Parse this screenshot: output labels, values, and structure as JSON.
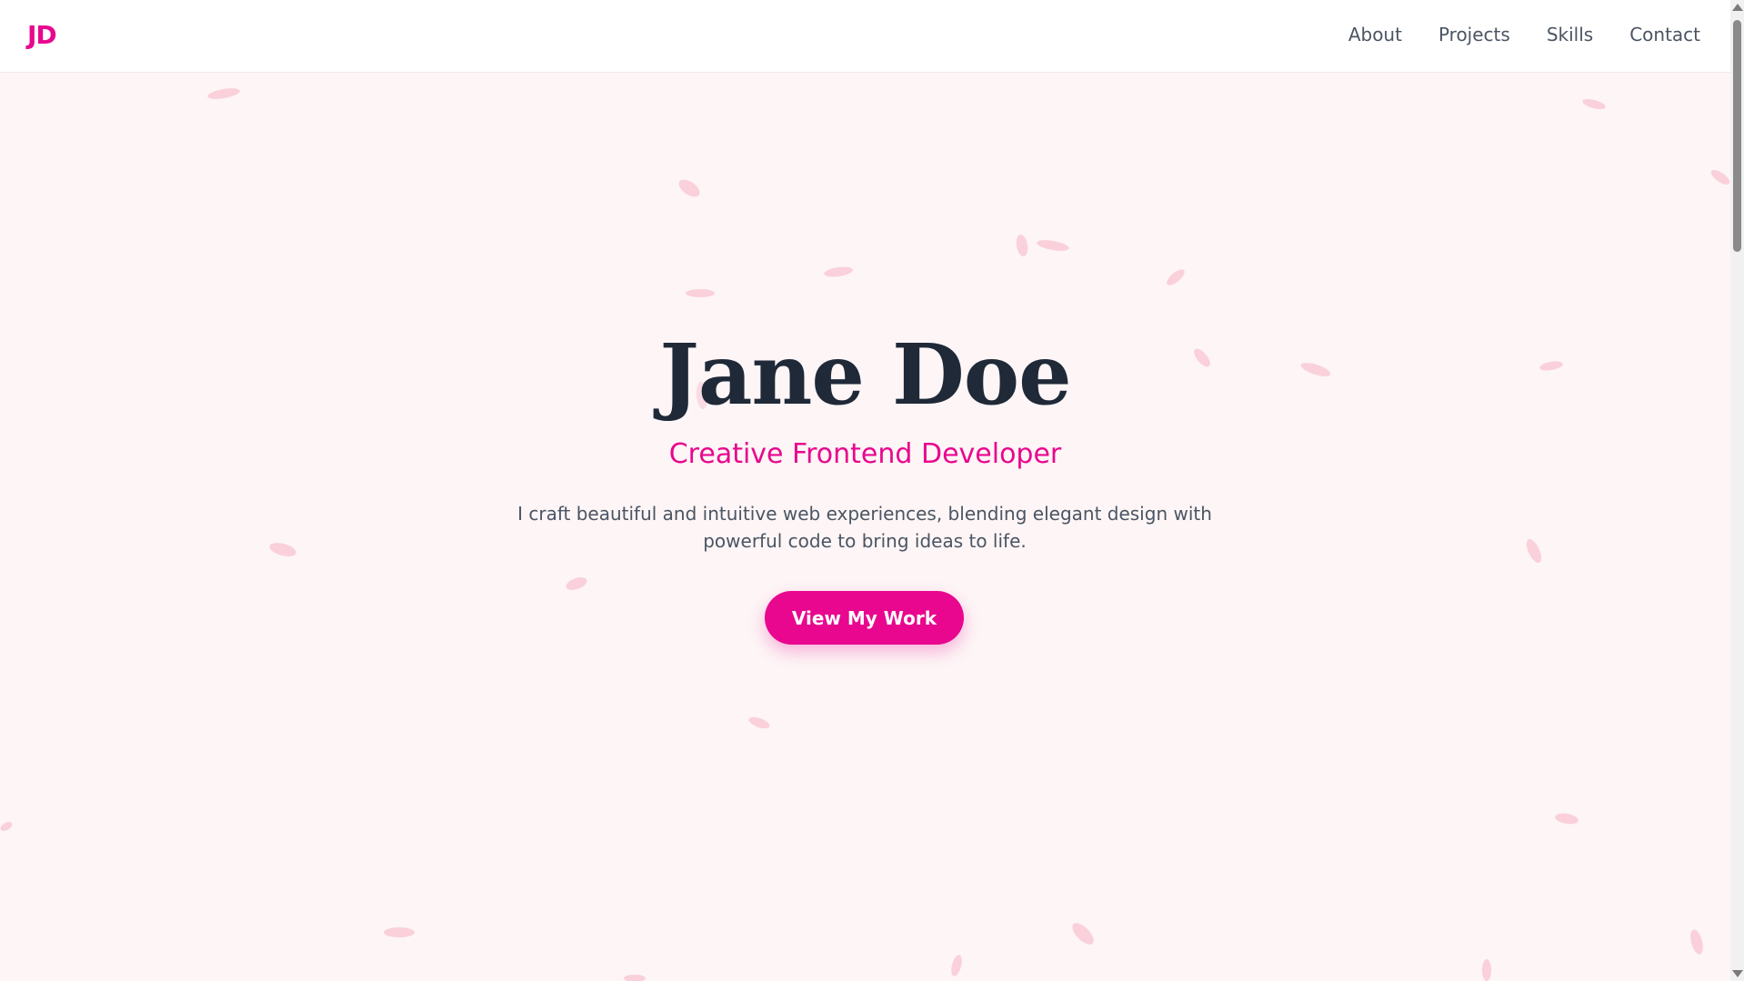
{
  "nav": {
    "logo": "JD",
    "links": [
      "About",
      "Projects",
      "Skills",
      "Contact"
    ]
  },
  "hero": {
    "title": "Jane Doe",
    "subtitle": "Creative Frontend Developer",
    "description": "I craft beautiful and intuitive web experiences, blending elegant design with powerful code to bring ideas to life.",
    "cta_label": "View My Work"
  },
  "colors": {
    "accent": "#e8078e",
    "heading": "#1f2937",
    "body_text": "#4b5563",
    "background": "#fdf5f6",
    "petal": "#f9c9d6"
  },
  "icons": [
    "scroll-up-arrow-icon",
    "scroll-down-arrow-icon"
  ]
}
